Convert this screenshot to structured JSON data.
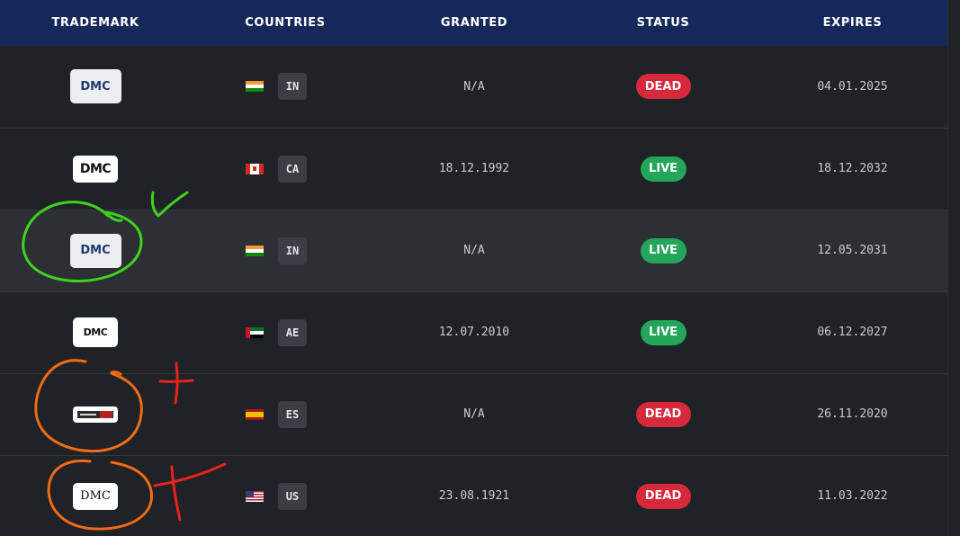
{
  "headers": {
    "trademark": "TRADEMARK",
    "countries": "COUNTRIES",
    "granted": "GRANTED",
    "status": "STATUS",
    "expires": "EXPIRES"
  },
  "rows": [
    {
      "logo_text": "DMC",
      "country_code": "IN",
      "flag": "india-flag-icon",
      "granted": "N/A",
      "status": "DEAD",
      "expires": "04.01.2025"
    },
    {
      "logo_text": "DMC",
      "country_code": "CA",
      "flag": "canada-flag-icon",
      "granted": "18.12.1992",
      "status": "LIVE",
      "expires": "18.12.2032"
    },
    {
      "logo_text": "DMC",
      "country_code": "IN",
      "flag": "india-flag-icon",
      "granted": "N/A",
      "status": "LIVE",
      "expires": "12.05.2031"
    },
    {
      "logo_text": "DMC",
      "country_code": "AE",
      "flag": "uae-flag-icon",
      "granted": "12.07.2010",
      "status": "LIVE",
      "expires": "06.12.2027"
    },
    {
      "logo_text": "",
      "country_code": "ES",
      "flag": "spain-flag-icon",
      "granted": "N/A",
      "status": "DEAD",
      "expires": "26.11.2020"
    },
    {
      "logo_text": "DMC",
      "country_code": "US",
      "flag": "us-flag-icon",
      "granted": "23.08.1921",
      "status": "DEAD",
      "expires": "11.03.2022"
    }
  ],
  "colors": {
    "header_bg": "#14295a",
    "row_bg": "#1f2226",
    "highlight_row_bg": "#2c2f33",
    "dead": "#d8283c",
    "live": "#23a55a",
    "annotation_green": "#3fd21e",
    "annotation_orange": "#f26a12",
    "annotation_red": "#e8231f"
  }
}
